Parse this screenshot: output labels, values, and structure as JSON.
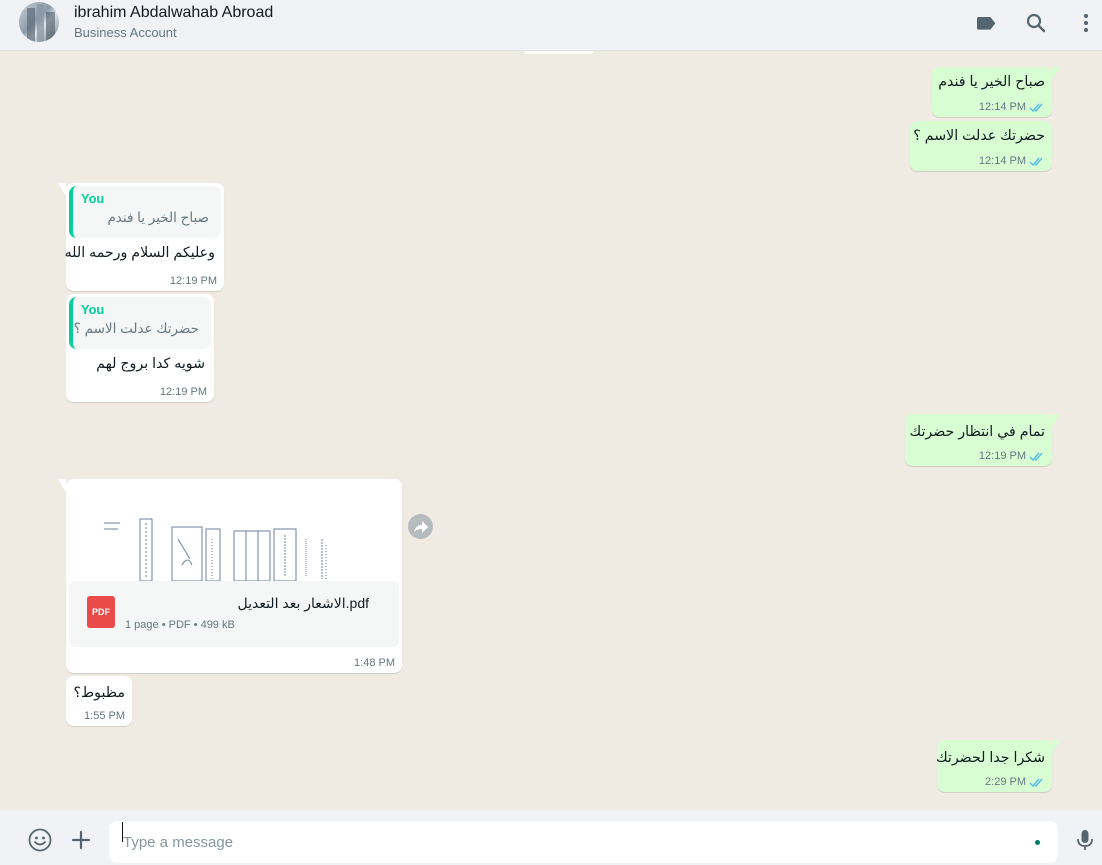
{
  "header": {
    "contact_name": "ibrahim Abdalwahab Abroad",
    "contact_subtitle": "Business Account",
    "icons": [
      "label-icon",
      "search-icon",
      "menu-icon"
    ]
  },
  "messages": [
    {
      "direction": "out",
      "text": "صباح الخير يا فندم",
      "time": "12:14 PM",
      "status": "read"
    },
    {
      "direction": "out",
      "text": "حضرتك عدلت الاسم ؟",
      "time": "12:14 PM",
      "status": "read"
    },
    {
      "direction": "in",
      "quote_author": "You",
      "quote_text": "صباح الخير يا فندم",
      "text": "وعليكم السلام ورحمه الله",
      "time": "12:19 PM"
    },
    {
      "direction": "in",
      "quote_author": "You",
      "quote_text": "حضرتك عدلت الاسم ؟",
      "text": "شويه كدا بروج لهم",
      "time": "12:19 PM"
    },
    {
      "direction": "out",
      "text": "تمام في انتظار حضرتك",
      "time": "12:19 PM",
      "status": "read"
    },
    {
      "direction": "in",
      "type": "document",
      "file_badge": "PDF",
      "file_name": "الاشعار بعد التعديل.pdf",
      "file_info": "1 page • PDF • 499 kB",
      "time": "1:48 PM"
    },
    {
      "direction": "in",
      "text": "مظبوط؟",
      "time": "1:55 PM"
    },
    {
      "direction": "out",
      "text": "شكرا جدا لحضرتك",
      "time": "2:29 PM",
      "status": "read"
    }
  ],
  "composer": {
    "placeholder": "Type a message",
    "icons": [
      "emoji-icon",
      "attach-plus-icon",
      "microphone-icon"
    ]
  },
  "colors": {
    "outgoing_bubble": "#d9fdd3",
    "incoming_bubble": "#ffffff",
    "chat_background": "#efeae2",
    "quote_accent": "#06cf9c",
    "read_ticks": "#53bdeb",
    "pdf_badge": "#e94a4a"
  }
}
